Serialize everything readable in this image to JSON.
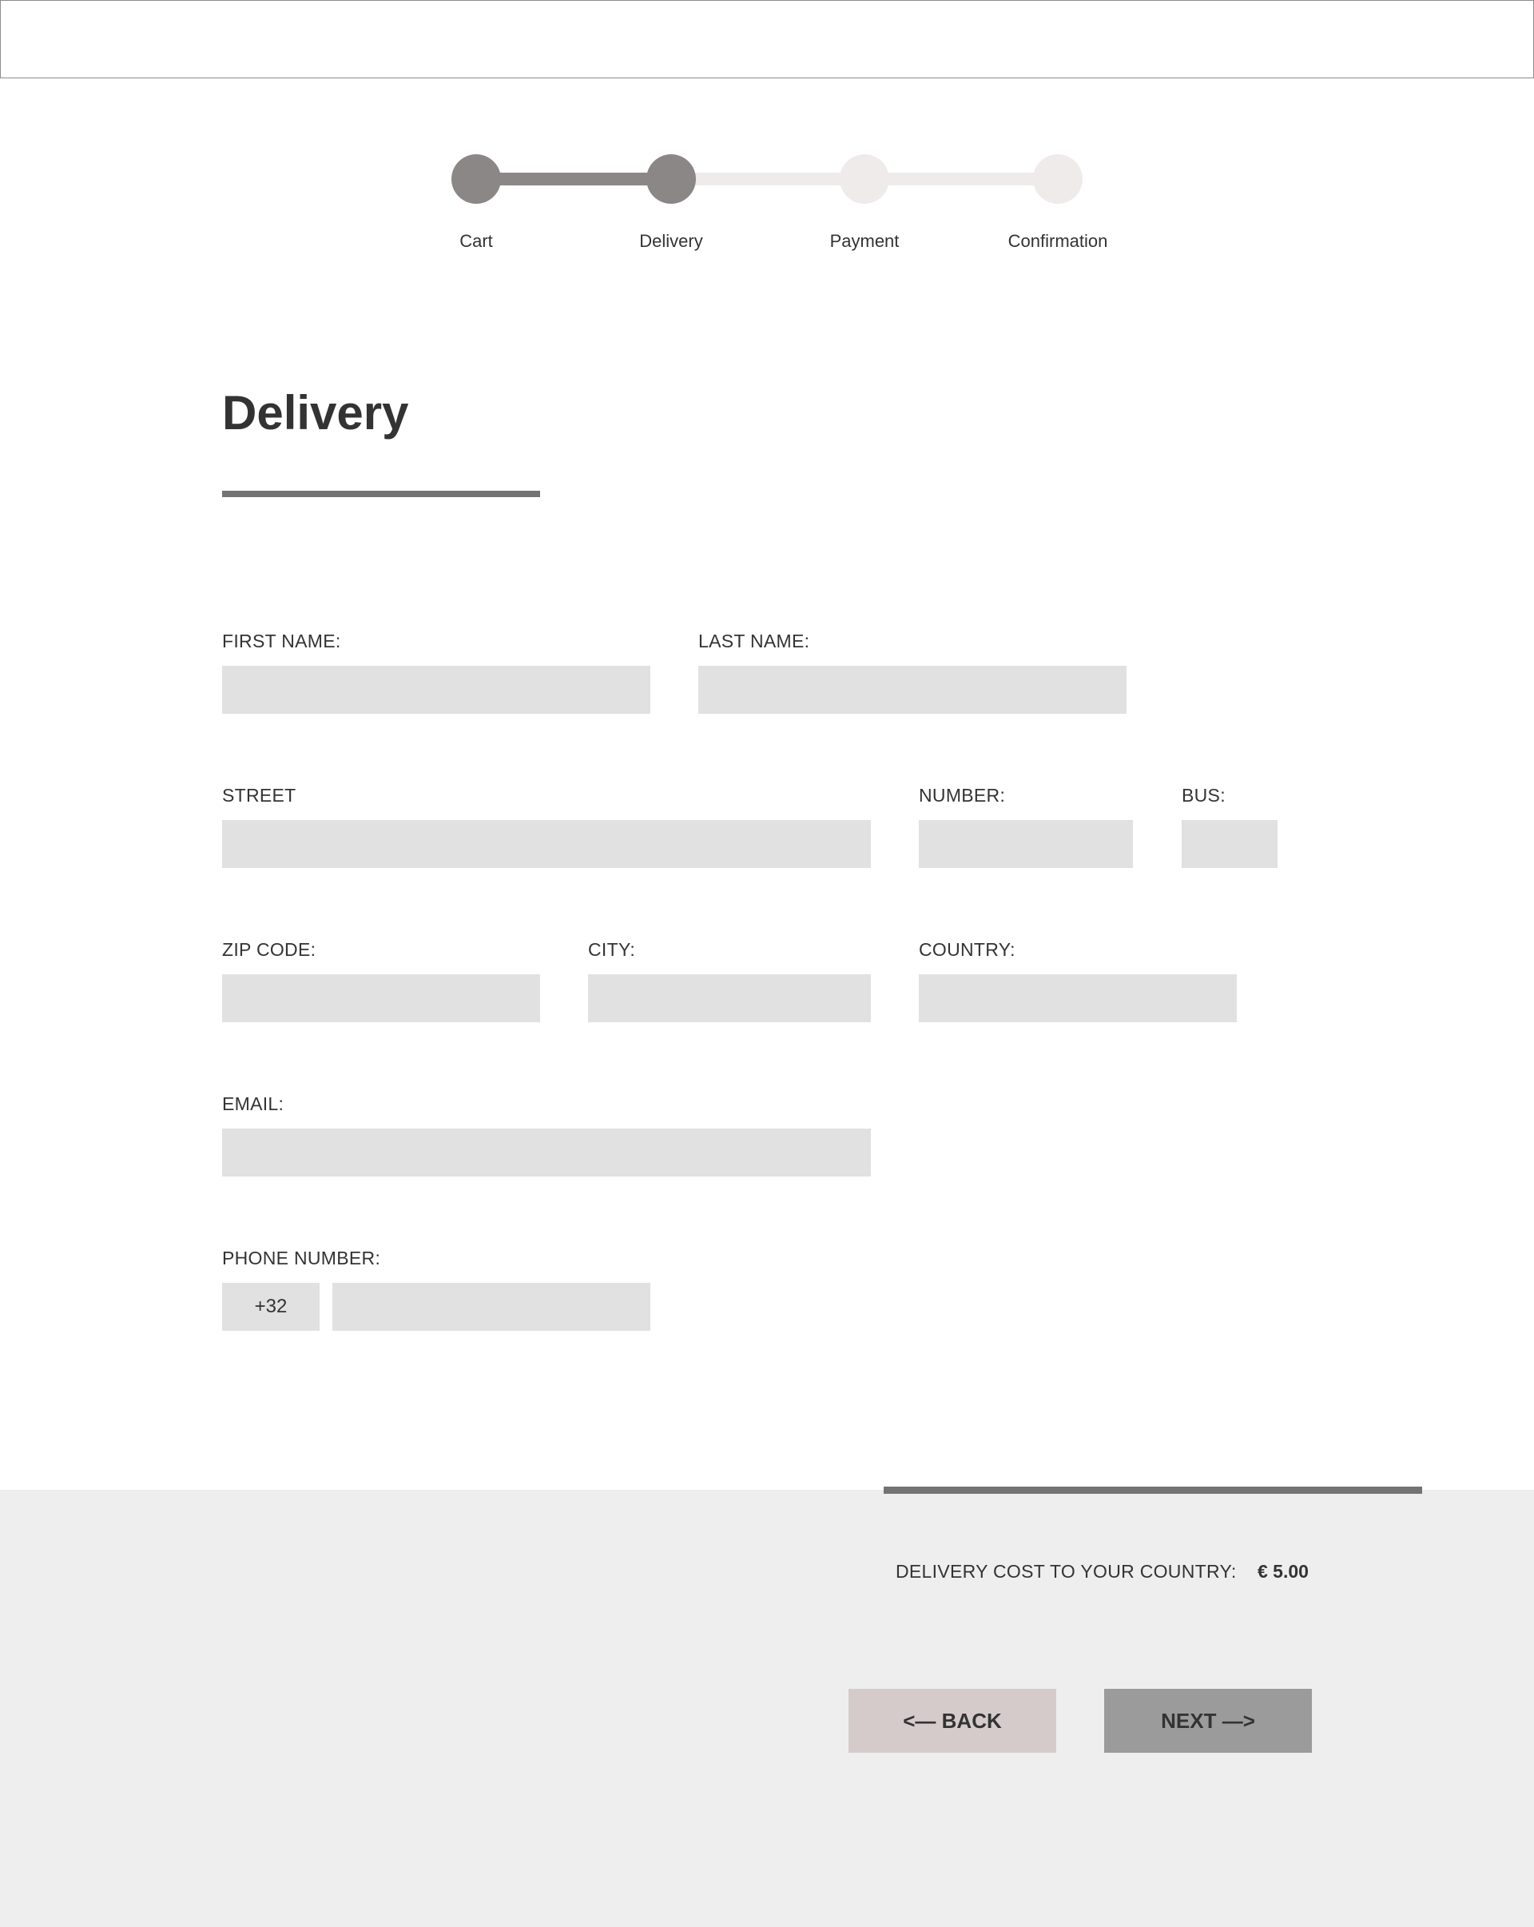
{
  "steps": [
    {
      "label": "Cart",
      "state": "done"
    },
    {
      "label": "Delivery",
      "state": "done"
    },
    {
      "label": "Payment",
      "state": "todo"
    },
    {
      "label": "Confirmation",
      "state": "todo"
    }
  ],
  "page": {
    "title": "Delivery"
  },
  "form": {
    "first_name_label": "FIRST NAME:",
    "first_name_value": "",
    "last_name_label": "LAST NAME:",
    "last_name_value": "",
    "street_label": "STREET",
    "street_value": "",
    "number_label": "NUMBER:",
    "number_value": "",
    "bus_label": "BUS:",
    "bus_value": "",
    "zip_label": "ZIP CODE:",
    "zip_value": "",
    "city_label": "CITY:",
    "city_value": "",
    "country_label": "COUNTRY:",
    "country_value": "",
    "email_label": "EMAIL:",
    "email_value": "",
    "phone_label": "PHONE NUMBER:",
    "phone_prefix": "+32",
    "phone_value": ""
  },
  "footer": {
    "delivery_cost_label": "DELIVERY COST TO YOUR COUNTRY:",
    "delivery_cost_value": "€ 5.00",
    "back_label": "<— BACK",
    "next_label": "NEXT —>"
  },
  "colors": {
    "step_done": "#8c8787",
    "step_todo": "#efebeb",
    "input_bg": "#e1e1e1",
    "footer_bg": "#eeeeee",
    "back_button": "#d5cbcb",
    "next_button": "#9b9b9b",
    "text": "#333333"
  }
}
